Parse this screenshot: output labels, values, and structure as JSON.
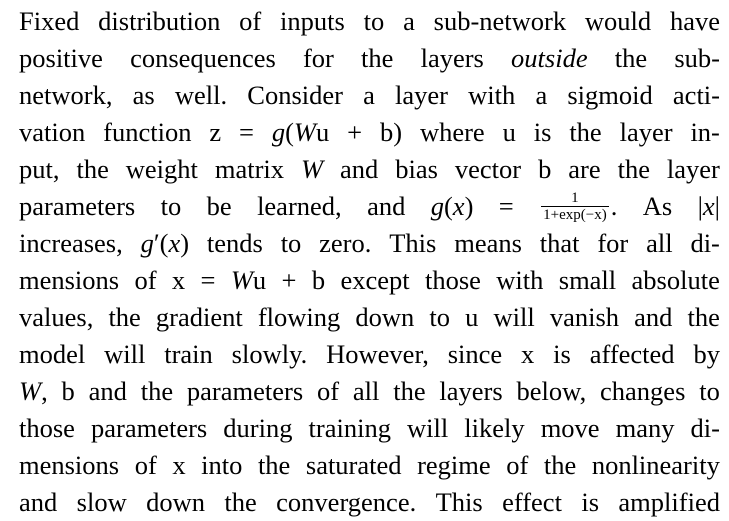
{
  "paragraph": {
    "lines": [
      "Fixed distribution of inputs to a sub-network would have",
      "positive consequences for the layers outside the sub-",
      "network, as well. Consider a layer with a sigmoid acti-",
      "vation function z = g(Wu + b) where u is the layer in-",
      "put, the weight matrix W and bias vector b are the layer",
      "parameters to be learned, and g(x) = 1/(1+exp(−x)). As |x|",
      "increases, g′(x) tends to zero. This means that for all di-",
      "mensions of x = Wu + b except those with small absolute",
      "values, the gradient flowing down to u will vanish and the",
      "model will train slowly. However, since x is affected by",
      "W, b and the parameters of all the layers below, changes to",
      "those parameters during training will likely move many di-",
      "mensions of x into the saturated regime of the nonlinearity",
      "and slow down the convergence. This effect is amplified"
    ],
    "fraction_numerator": "1",
    "fraction_denominator": "1+exp(−x)"
  }
}
